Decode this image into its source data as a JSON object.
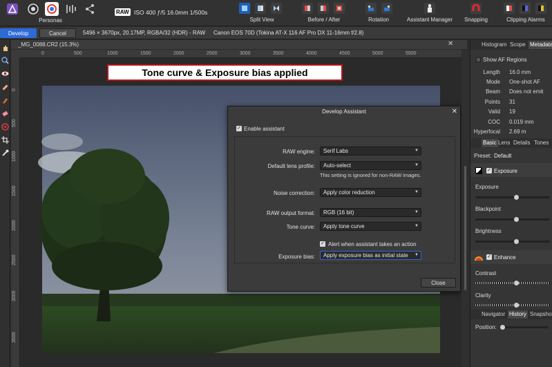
{
  "toolbar": {
    "personas_label": "Personas",
    "raw_badge": "RAW",
    "exif": "ISO 400  ƒ/5  16.0mm  1/500s",
    "split_view": "Split View",
    "before_after": "Before / After",
    "rotation": "Rotation",
    "assistant_manager": "Assistant Manager",
    "snapping": "Snapping",
    "clipping_alarms": "Clipping Alarms",
    "persona_icons": [
      "photo-persona-icon",
      "liquify-persona-icon",
      "develop-persona-icon",
      "tone-mapping-persona-icon",
      "export-persona-icon"
    ]
  },
  "context": {
    "develop": "Develop",
    "cancel": "Cancel",
    "image_info": "5496 × 3670px, 20.17MP, RGBA/32 (HDR) - RAW",
    "camera_info": "Canon EOS 70D (Tokina AT-X 116 AF Pro DX 11-16mm f/2.8)"
  },
  "document": {
    "title": "_MG_0088.CR2 (15.3%)",
    "close": "✕",
    "ruler_h": [
      "0",
      "500",
      "1000",
      "1500",
      "2000",
      "2500",
      "3000",
      "3500",
      "4000",
      "4500",
      "5000",
      "5500"
    ],
    "ruler_v": [
      "0",
      "500",
      "1000",
      "1500",
      "2000",
      "2500",
      "3000",
      "3500"
    ]
  },
  "caption": "Tone curve & Exposure bias applied",
  "dialog": {
    "title": "Develop Assistant",
    "close": "✕",
    "enable_label": "Enable assistant",
    "enable_checked": true,
    "raw_engine_label": "RAW engine:",
    "raw_engine_value": "Serif Labs",
    "lens_profile_label": "Default lens profile:",
    "lens_profile_value": "Auto-select",
    "lens_note": "This setting is ignored for non-RAW images.",
    "noise_label": "Noise correction:",
    "noise_value": "Apply color reduction",
    "raw_output_label": "RAW output format:",
    "raw_output_value": "RGB (16 bit)",
    "tone_curve_label": "Tone curve:",
    "tone_curve_value": "Apply tone curve",
    "alert_label": "Alert when assistant takes an action",
    "alert_checked": true,
    "exposure_bias_label": "Exposure bias:",
    "exposure_bias_value": "Apply exposure bias as initial state",
    "close_button": "Close",
    "check_mark": "✓",
    "dropdown_arrow": "▼"
  },
  "right_panel": {
    "top_tabs": [
      "Histogram",
      "Scope",
      "Metadata"
    ],
    "show_af_regions": "Show AF Regions",
    "af_info": [
      {
        "k": "Length",
        "v": "16.0 mm"
      },
      {
        "k": "Mode",
        "v": "One-shot AF"
      },
      {
        "k": "Beam",
        "v": "Does not emit"
      },
      {
        "k": "Points",
        "v": "31"
      },
      {
        "k": "Valid",
        "v": "19"
      },
      {
        "k": "COC",
        "v": "0.019 mm"
      },
      {
        "k": "Hyperfocal",
        "v": "2.69 m"
      }
    ],
    "develop_tabs": [
      "Basic",
      "Lens",
      "Details",
      "Tones"
    ],
    "preset_label": "Preset:",
    "preset_value": "Default",
    "exposure_group": "Exposure",
    "exposure_label": "Exposure",
    "exposure_value": 0.55,
    "blackpoint_label": "Blackpoint",
    "blackpoint_value": 0.55,
    "brightness_label": "Brightness",
    "brightness_value": 0.55,
    "enhance_group": "Enhance",
    "contrast_label": "Contrast",
    "contrast_value": 0.55,
    "clarity_label": "Clarity",
    "clarity_value": 0.55,
    "bottom_tabs": [
      "Navigator",
      "History",
      "Snapshots"
    ],
    "position_label": "Position:"
  },
  "colors": {
    "accent": "#2d6bd6",
    "caption_border": "#c1121c",
    "snapping": "#e0282e"
  }
}
